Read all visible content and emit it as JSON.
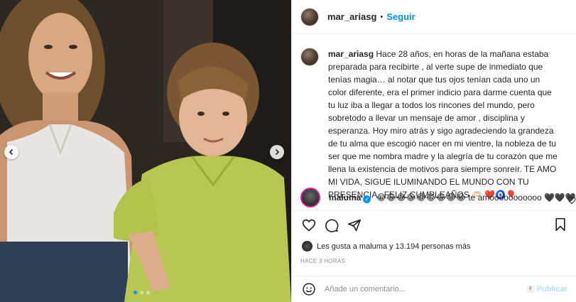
{
  "post": {
    "author": "mar_ariasg",
    "separator": "•",
    "follow_label": "Seguir",
    "carousel_position": 1,
    "carousel_count": 3
  },
  "caption": {
    "username": "mar_ariasg",
    "text": " Hace 28 años, en horas de la mañana estaba preparada para recibirte , al verte supe de inmediato que tenías magia… al notar que tus ojos tenían cada uno un color diferente, era el primer indicio para darme cuenta que tu luz iba a llegar a todos los rincones del mundo, pero sobretodo a llevar un mensaje de amor , disciplina y esperanza. Hoy miro atrás y sigo agradeciendo la grandeza de tu alma que escogió nacer en mi vientre, la nobleza de tu ser que me nombra madre y la alegría de tu corazón que me llena la existencia de motivos para siempre sonreír. TE AMO MI VIDA, SIGUE ILUMINANDO EL MUNDO CON TU PRESENCIA , FELIZ CUMPLEAÑOS 🫶🏻 ❤️🧿🎈",
    "time": "3 h"
  },
  "comment": {
    "username": "maluma",
    "verified_glyph": "✓",
    "text": " 😂😂😂😂😂😂😂😂😂 te amooooooooooo 🖤🖤🖤🖤"
  },
  "likes": {
    "text": "Les gusta a maluma y 13.194 personas más"
  },
  "timestamp": "HACE 3 HORAS",
  "composer": {
    "placeholder": "Añade un comentario...",
    "publish_label": "Publicar",
    "updown_glyph": "⇕"
  },
  "colors": {
    "accent": "#0095f6",
    "publish_disabled": "#b2dffc",
    "muted": "#8e8e8e"
  }
}
